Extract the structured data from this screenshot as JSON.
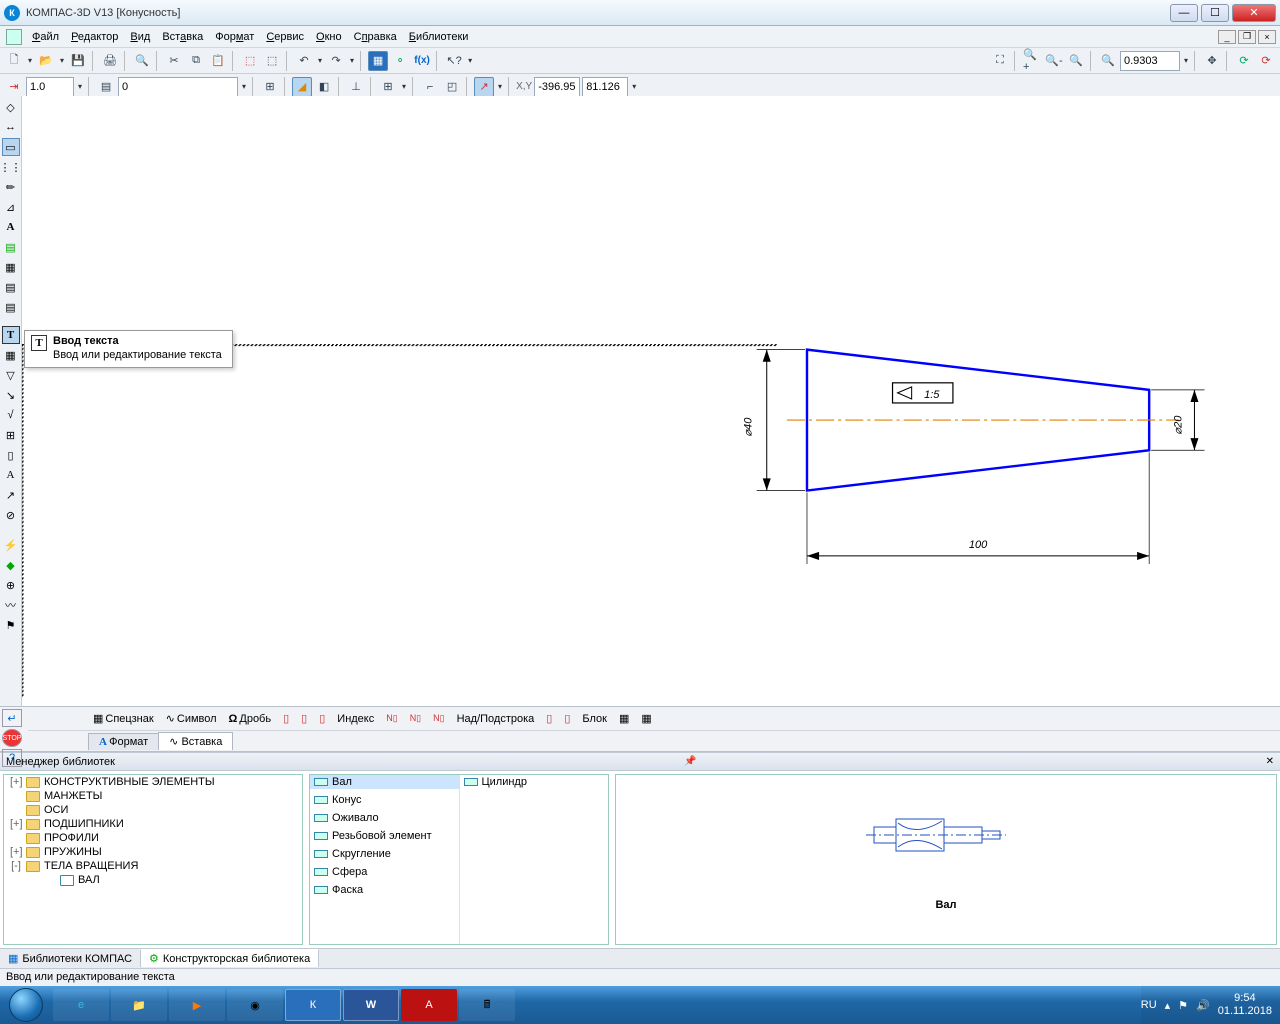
{
  "titlebar": {
    "app": "КОМПАС-3D V13",
    "doc": "[Конусность]"
  },
  "menus": [
    "Файл",
    "Редактор",
    "Вид",
    "Вставка",
    "Формат",
    "Сервис",
    "Окно",
    "Справка",
    "Библиотеки"
  ],
  "toolbar2": {
    "scale": "1.0",
    "style": "0",
    "zoom": "0.9303",
    "coord_x": "-396.95",
    "coord_y": "81.126"
  },
  "tooltip": {
    "title": "Ввод текста",
    "desc": "Ввод или редактирование текста"
  },
  "drawing": {
    "dim_left": "⌀40",
    "dim_right": "⌀20",
    "dim_bottom": "100",
    "taper": "1:5"
  },
  "propbar": {
    "btn1": "Спецзнак",
    "btn2": "Символ",
    "btn3": "Дробь",
    "btn4": "Индекс",
    "btn5": "Над/Подстрока",
    "btn6": "Блок",
    "tabs": [
      "Формат",
      "Вставка"
    ],
    "active_tab": 1
  },
  "libmgr": {
    "header": "Менеджер библиотек",
    "tree": [
      {
        "exp": "+",
        "label": "КОНСТРУКТИВНЫЕ ЭЛЕМЕНТЫ"
      },
      {
        "exp": "",
        "label": "МАНЖЕТЫ"
      },
      {
        "exp": "",
        "label": "ОСИ"
      },
      {
        "exp": "+",
        "label": "ПОДШИПНИКИ"
      },
      {
        "exp": "",
        "label": "ПРОФИЛИ"
      },
      {
        "exp": "+",
        "label": "ПРУЖИНЫ"
      },
      {
        "exp": "-",
        "label": "ТЕЛА ВРАЩЕНИЯ"
      },
      {
        "exp": "",
        "label": "ВАЛ",
        "indent": true,
        "open": true
      }
    ],
    "grid_left": [
      "Вал",
      "Конус",
      "Оживало",
      "Резьбовой элемент",
      "Скругление",
      "Сфера",
      "Фаска"
    ],
    "grid_right": [
      "Цилиндр"
    ],
    "preview_label": "Вал",
    "tabs": [
      "Библиотеки КОМПАС",
      "Конструкторская библиотека"
    ],
    "active_tab": 1
  },
  "status": "Ввод или редактирование текста",
  "tray": {
    "lang": "RU",
    "time": "9:54",
    "date": "01.11.2018"
  }
}
